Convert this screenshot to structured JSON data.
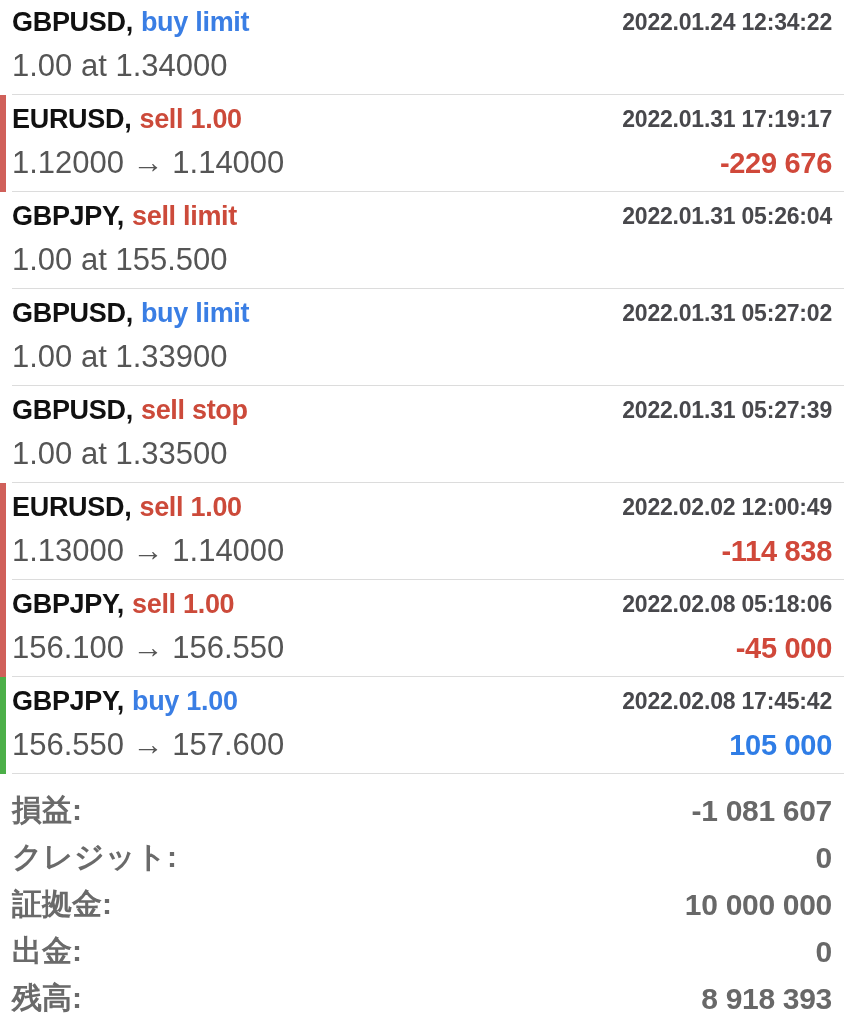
{
  "orders": [
    {
      "kind": "order",
      "symbol": "GBPUSD,",
      "type": "buy limit",
      "sell": false,
      "details": "1.00 at 1.34000",
      "time": "2022.01.24 12:34:22"
    },
    {
      "kind": "position",
      "symbol": "EURUSD,",
      "type": "sell 1.00",
      "sell": true,
      "details": "1.12000 → 1.14000",
      "time": "2022.01.31 17:19:17",
      "profit": "-229 676",
      "loss": true
    },
    {
      "kind": "order",
      "symbol": "GBPJPY,",
      "type": "sell limit",
      "sell": true,
      "details": "1.00 at 155.500",
      "time": "2022.01.31 05:26:04"
    },
    {
      "kind": "order",
      "symbol": "GBPUSD,",
      "type": "buy limit",
      "sell": false,
      "details": "1.00 at 1.33900",
      "time": "2022.01.31 05:27:02"
    },
    {
      "kind": "order",
      "symbol": "GBPUSD,",
      "type": "sell stop",
      "sell": true,
      "details": "1.00 at 1.33500",
      "time": "2022.01.31 05:27:39"
    },
    {
      "kind": "position",
      "symbol": "EURUSD,",
      "type": "sell 1.00",
      "sell": true,
      "details": "1.13000 → 1.14000",
      "time": "2022.02.02 12:00:49",
      "profit": "-114 838",
      "loss": true
    },
    {
      "kind": "position",
      "symbol": "GBPJPY,",
      "type": "sell 1.00",
      "sell": true,
      "details": "156.100 → 156.550",
      "time": "2022.02.08 05:18:06",
      "profit": "-45 000",
      "loss": true
    },
    {
      "kind": "position",
      "symbol": "GBPJPY,",
      "type": "buy 1.00",
      "sell": false,
      "details": "156.550 → 157.600",
      "time": "2022.02.08 17:45:42",
      "profit": "105 000",
      "loss": false
    }
  ],
  "summary": [
    {
      "label": "損益:",
      "value": "-1 081 607"
    },
    {
      "label": "クレジット:",
      "value": "0"
    },
    {
      "label": "証拠金:",
      "value": "10 000 000"
    },
    {
      "label": "出金:",
      "value": "0"
    },
    {
      "label": "残高:",
      "value": "8 918 393"
    }
  ]
}
